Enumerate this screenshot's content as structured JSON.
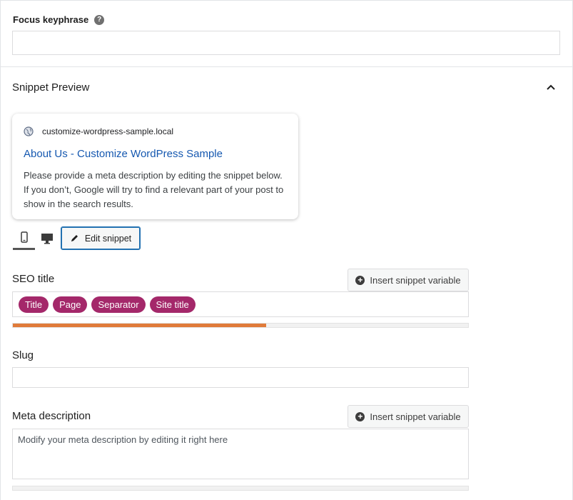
{
  "focus_keyphrase": {
    "label": "Focus keyphrase",
    "help_icon": "question-circle-icon",
    "help_glyph": "?",
    "value": ""
  },
  "snippet_preview": {
    "heading": "Snippet Preview",
    "collapse_icon": "chevron-up-icon",
    "card": {
      "url": "customize-wordpress-sample.local",
      "title": "About Us - Customize WordPress Sample",
      "description": "Please provide a meta description by editing the snippet below. If you don’t, Google will try to find a relevant part of your post to show in the search results.",
      "title_color": "#1558b0"
    },
    "mode_buttons": {
      "mobile_icon": "mobile-icon",
      "desktop_icon": "desktop-icon",
      "active": "mobile"
    },
    "edit_snippet_label": "Edit snippet"
  },
  "seo_title": {
    "label": "SEO title",
    "insert_variable_label": "Insert snippet variable",
    "insert_glyph": "+",
    "variables": [
      "Title",
      "Page",
      "Separator",
      "Site title"
    ],
    "pill_color": "#a4286a",
    "progress_fraction": 0.557,
    "progress_color": "#e07b3a"
  },
  "slug": {
    "label": "Slug",
    "value": ""
  },
  "meta_description": {
    "label": "Meta description",
    "insert_variable_label": "Insert snippet variable",
    "insert_glyph": "+",
    "placeholder": "Modify your meta description by editing it right here",
    "progress_fraction": 0
  }
}
